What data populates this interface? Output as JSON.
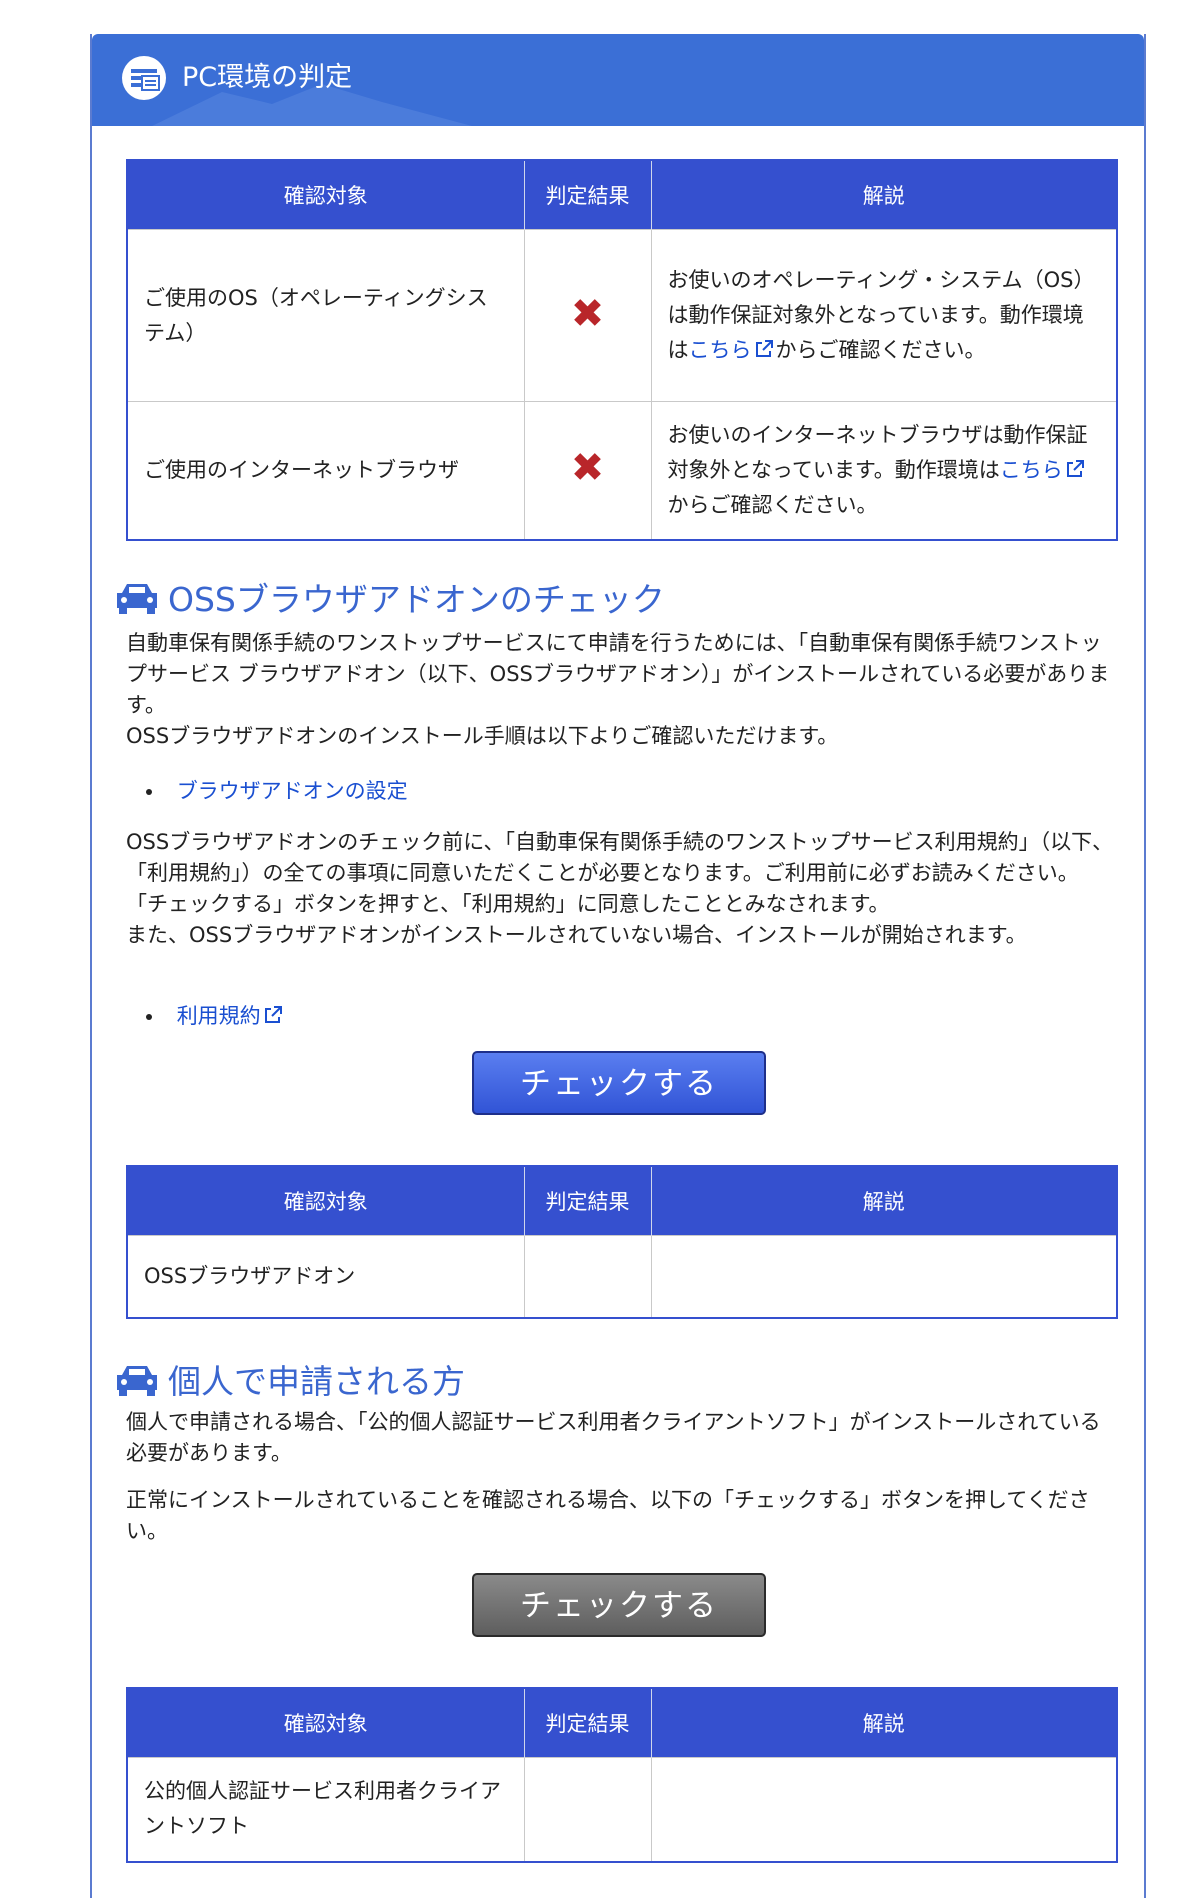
{
  "header": {
    "title": "PC環境の判定"
  },
  "colors": {
    "header_bg": "#3b6fd6",
    "table_header": "#3550cf",
    "link": "#1a4fd1",
    "fail_mark": "#b9262a"
  },
  "table_headers": [
    "確認対象",
    "判定結果",
    "解説"
  ],
  "env_table": {
    "rows": [
      {
        "target": "ご使用のOS（オペレーティングシステム）",
        "result": "✖",
        "desc_before": "お使いのオペレーティング・システム（OS）は動作保証対象外となっています。動作環境は",
        "desc_link": "こちら",
        "desc_after": "からご確認ください。"
      },
      {
        "target": "ご使用のインターネットブラウザ",
        "result": "✖",
        "desc_before": "お使いのインターネットブラウザは動作保証対象外となっています。動作環境は",
        "desc_link": "こちら",
        "desc_after": "からご確認ください。"
      }
    ]
  },
  "oss_section": {
    "heading": "OSSブラウザアドオンのチェック",
    "intro": "自動車保有関係手続のワンストップサービスにて申請を行うためには、「自動車保有関係手続ワンストップサービス ブラウザアドオン（以下、OSSブラウザアドオン）」がインストールされている必要があります。",
    "intro2": "OSSブラウザアドオンのインストール手順は以下よりご確認いただけます。",
    "link1": "ブラウザアドオンの設定",
    "notice1": "OSSブラウザアドオンのチェック前に、「自動車保有関係手続のワンストップサービス利用規約」（以下、「利用規約」）の全ての事項に同意いただくことが必要となります。ご利用前に必ずお読みください。",
    "notice2": "「チェックする」ボタンを押すと、「利用規約」に同意したこととみなされます。",
    "notice3": "また、OSSブラウザアドオンがインストールされていない場合、インストールが開始されます。",
    "link2": "利用規約",
    "button": "チェックする",
    "table_row": {
      "target": "OSSブラウザアドオン",
      "result": "",
      "desc": ""
    }
  },
  "personal_section": {
    "heading": "個人で申請される方",
    "intro": "個人で申請される場合、「公的個人認証サービス利用者クライアントソフト」がインストールされている必要があります。",
    "intro2": "正常にインストールされていることを確認される場合、以下の「チェックする」ボタンを押してください。",
    "button": "チェックする",
    "table_row": {
      "target": "公的個人認証サービス利用者クライアントソフト",
      "result": "",
      "desc": ""
    }
  }
}
